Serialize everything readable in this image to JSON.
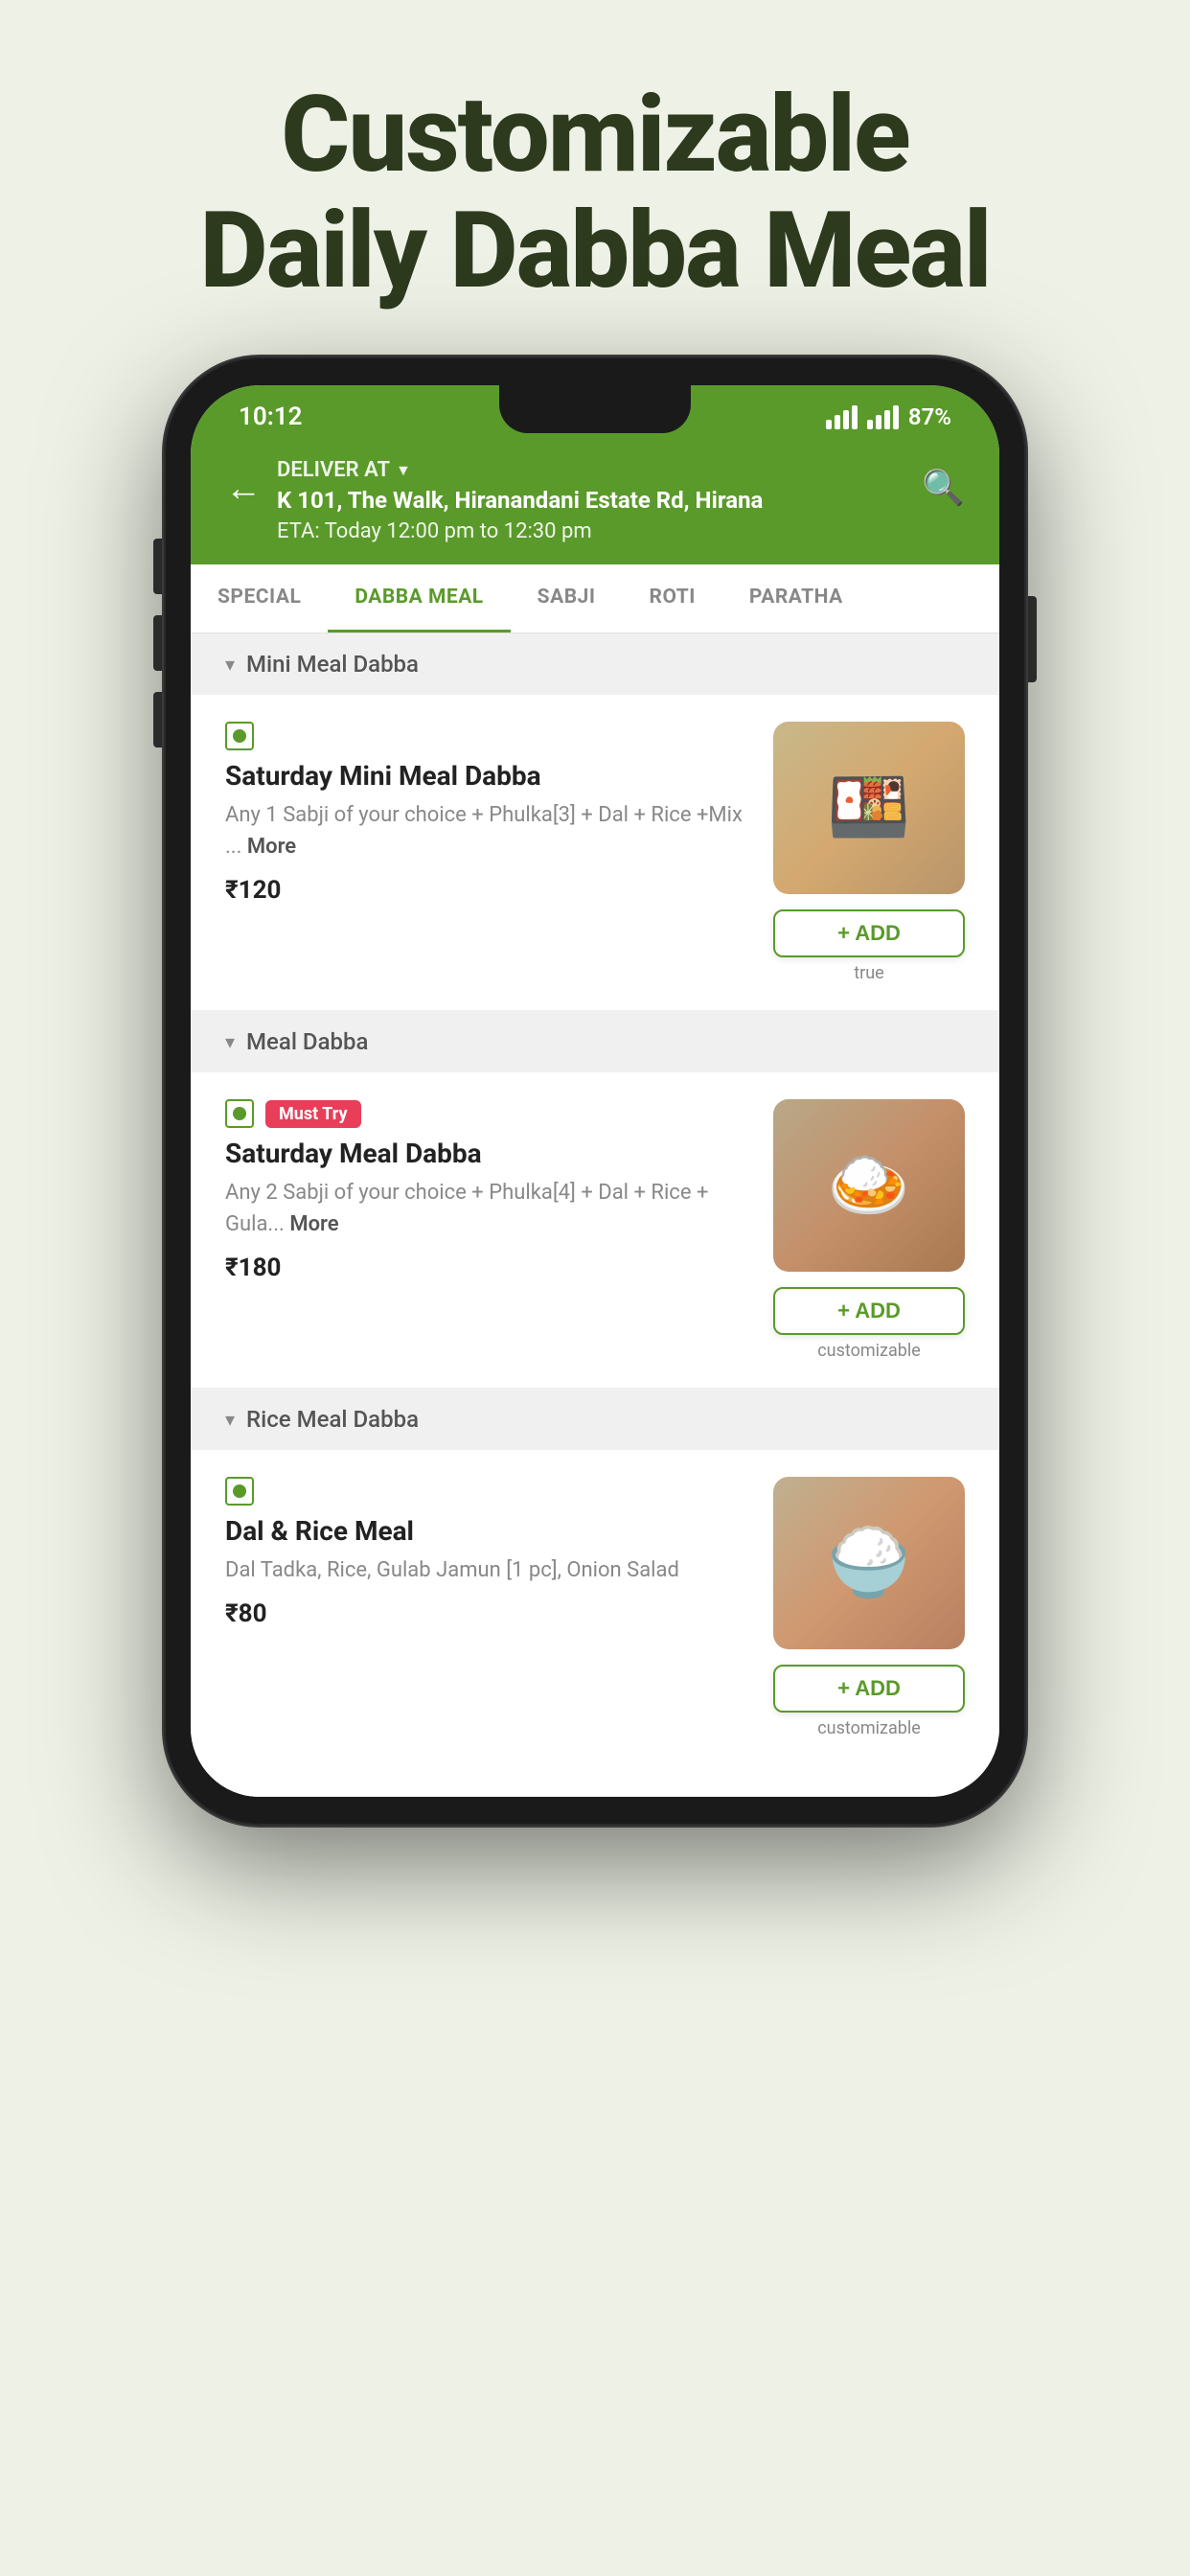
{
  "hero": {
    "title_line1": "Customizable",
    "title_line2": "Daily Dabba Meal"
  },
  "status_bar": {
    "time": "10:12",
    "battery": "87%"
  },
  "header": {
    "deliver_at_label": "DELIVER AT",
    "address": "K 101, The Walk, Hiranandani Estate Rd, Hirana",
    "eta": "ETA: Today 12:00 pm to 12:30 pm"
  },
  "tabs": [
    {
      "label": "SPECIAL",
      "active": false
    },
    {
      "label": "DABBA MEAL",
      "active": true
    },
    {
      "label": "SABJI",
      "active": false
    },
    {
      "label": "ROTI",
      "active": false
    },
    {
      "label": "PARATHA",
      "active": false
    }
  ],
  "sections": [
    {
      "title": "Mini Meal Dabba",
      "items": [
        {
          "name": "Saturday Mini Meal Dabba",
          "description": "Any 1 Sabji of your choice + Phulka[3] + Dal + Rice +Mix ...",
          "more": "More",
          "price": "₹120",
          "is_veg": true,
          "must_try": false,
          "customizable": true,
          "add_label": "+ ADD"
        }
      ]
    },
    {
      "title": "Meal Dabba",
      "items": [
        {
          "name": "Saturday Meal Dabba",
          "description": "Any 2 Sabji of your choice + Phulka[4] + Dal + Rice + Gula...",
          "more": "More",
          "price": "₹180",
          "is_veg": true,
          "must_try": true,
          "customizable": true,
          "add_label": "+ ADD"
        }
      ]
    },
    {
      "title": "Rice Meal Dabba",
      "items": [
        {
          "name": "Dal & Rice Meal",
          "description": "Dal Tadka, Rice, Gulab Jamun [1 pc], Onion Salad",
          "more": "",
          "price": "₹80",
          "is_veg": true,
          "must_try": false,
          "customizable": true,
          "add_label": "+ ADD"
        }
      ]
    }
  ],
  "labels": {
    "must_try": "Must Try",
    "customizable": "customizable",
    "back_arrow": "←",
    "search_icon": "🔍",
    "dropdown_arrow": "▼"
  }
}
